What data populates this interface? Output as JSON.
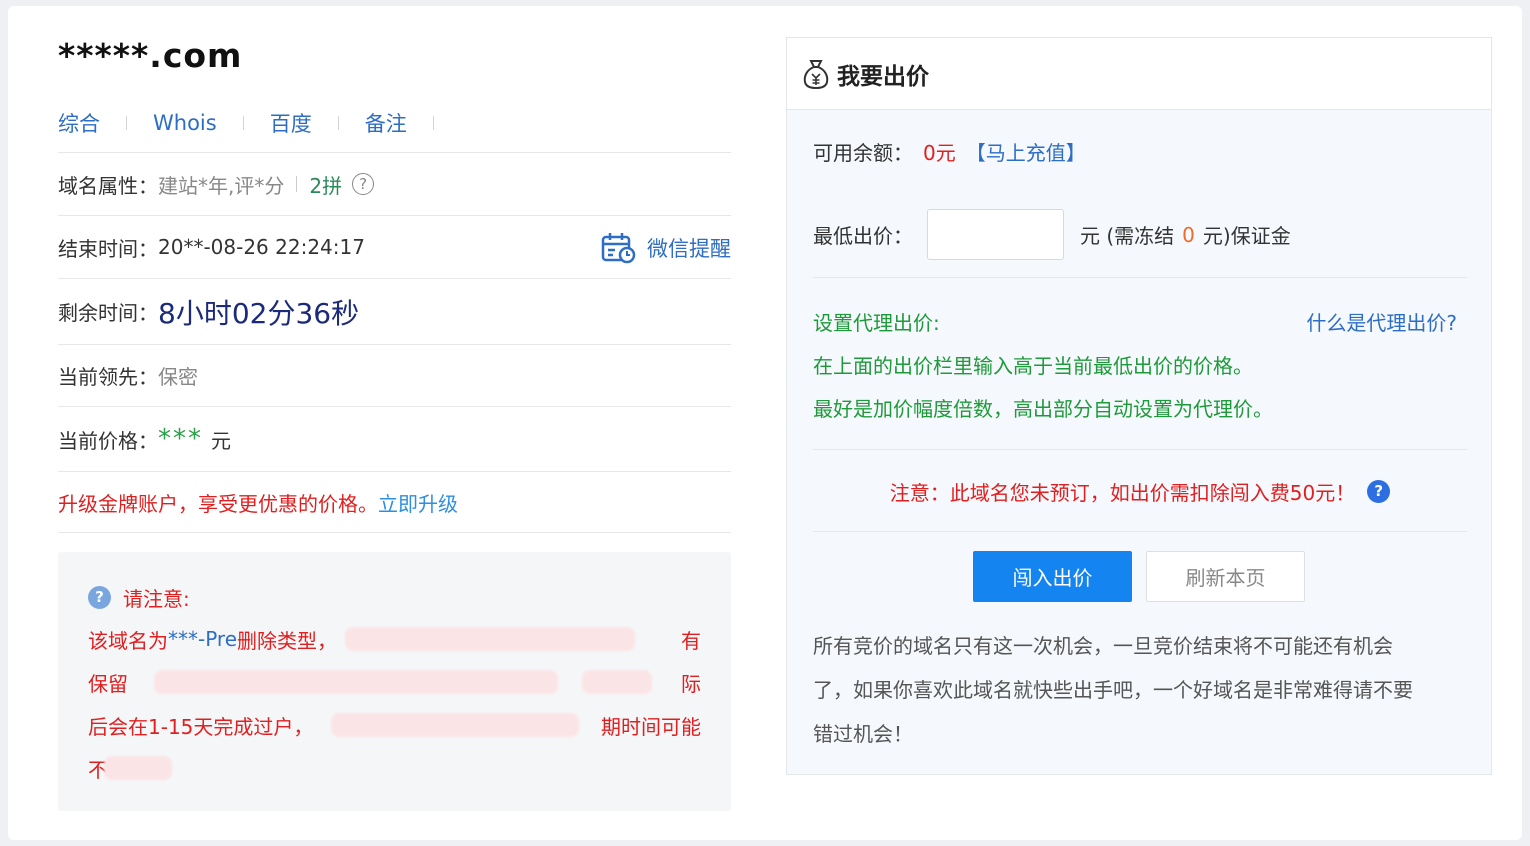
{
  "domain": {
    "name": "*****.com"
  },
  "tabs": [
    {
      "label": "综合"
    },
    {
      "label": "Whois"
    },
    {
      "label": "百度"
    },
    {
      "label": "备注"
    }
  ],
  "info": {
    "attr_label": "域名属性：",
    "attr_value": "建站*年,评*分",
    "attr_pin": "2拼",
    "attr_help": "?",
    "end_label": "结束时间：",
    "end_value": "20**-08-26 22:24:17",
    "wechat_remind": "微信提醒",
    "remaining_label": "剩余时间：",
    "remaining_value": "8小时02分36秒",
    "leader_label": "当前领先：",
    "leader_value": "保密",
    "price_label": "当前价格：",
    "price_value": "***",
    "price_unit": "元",
    "upgrade_text": "升级金牌账户，享受更优惠的价格。",
    "upgrade_link": "立即升级"
  },
  "notice": {
    "icon": "?",
    "title": "请注意:",
    "line1_a": "该域名为",
    "line1_b": "***-Pre",
    "line1_c": "删除类型，",
    "line1_end": "有",
    "line2_a": "保留",
    "line2_end": "际",
    "line3_a": "后会在1-15天完成过户，",
    "line3_end": "期时间可能",
    "line4_a": "不"
  },
  "bid": {
    "title": "我要出价",
    "balance_label": "可用余额：",
    "balance_value": "0元",
    "recharge": "【马上充值】",
    "min_label": "最低出价：",
    "min_input_value": "",
    "unit_prefix": "元 (需冻结",
    "freeze_value": "0",
    "unit_suffix": "元)保证金",
    "proxy_title": "设置代理出价:",
    "proxy_what": "什么是代理出价?",
    "proxy_line1": "在上面的出价栏里输入高于当前最低出价的价格。",
    "proxy_line2": "最好是加价幅度倍数，高出部分自动设置为代理价。",
    "attention": "注意：此域名您未预订，如出价需扣除闯入费50元！",
    "attention_help": "?",
    "btn_bid": "闯入出价",
    "btn_refresh": "刷新本页",
    "desc_line1": "所有竞价的域名只有这一次机会，一旦竞价结束将不可能还有机会",
    "desc_line2": "了，如果你喜欢此域名就快些出手吧，一个好域名是非常难得请不要",
    "desc_line3": "错过机会！"
  },
  "colors": {
    "link_blue": "#2d6ec4",
    "warn_red": "#e02020",
    "primary_button": "#1484f0",
    "proxy_green": "#1f9a3a",
    "remaining_navy": "#1b2a7a"
  }
}
